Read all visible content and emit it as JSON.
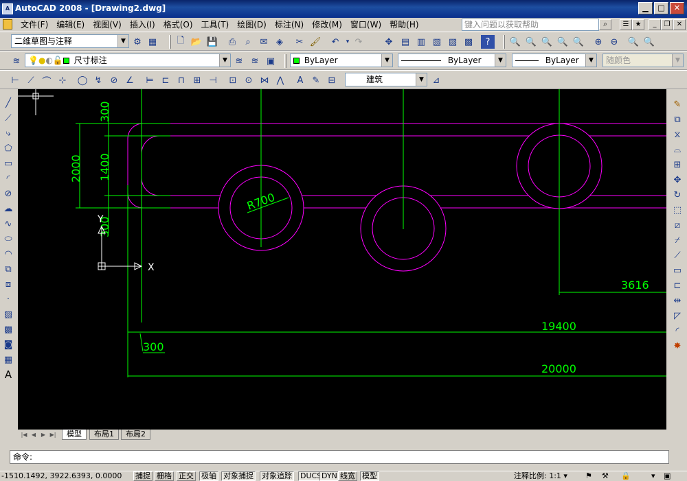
{
  "window": {
    "title": "AutoCAD 2008 - [Drawing2.dwg]",
    "icon": "autocad-icon",
    "minimize": "▁",
    "maximize": "□",
    "close": "✕"
  },
  "menubar": {
    "items": [
      "文件(F)",
      "编辑(E)",
      "视图(V)",
      "插入(I)",
      "格式(O)",
      "工具(T)",
      "绘图(D)",
      "标注(N)",
      "修改(M)",
      "窗口(W)",
      "帮助(H)"
    ],
    "help_search_placeholder": "键入问题以获取帮助"
  },
  "toolbars": {
    "workspace": "二维草图与注释",
    "layer": "尺寸标注",
    "color": "ByLayer",
    "linetype": "ByLayer",
    "lineweight": "ByLayer",
    "plotstyle": "随颜色",
    "dimstyle": "建筑"
  },
  "drawing": {
    "dimensions": {
      "vertical_300_top": "300",
      "vertical_1400": "1400",
      "vertical_2000": "2000",
      "vertical_300_bottom": "300",
      "radius": "R700",
      "horizontal_3616": "3616",
      "horizontal_19400": "19400",
      "horizontal_300": "300",
      "horizontal_20000": "20000"
    },
    "ucs_x": "X",
    "ucs_y": "Y",
    "colors": {
      "background": "#000000",
      "magenta": "#ff00ff",
      "green": "#00ff00",
      "white": "#ffffff"
    }
  },
  "layout_tabs": [
    "模型",
    "布局1",
    "布局2"
  ],
  "command_line": {
    "prompt": "命令:"
  },
  "statusbar": {
    "coordinates": "-1510.1492, 3922.6393, 0.0000",
    "toggles": [
      "捕捉",
      "栅格",
      "正交",
      "极轴",
      "对象捕捉",
      "对象追踪",
      "DUCS",
      "DYN",
      "线宽",
      "模型"
    ],
    "annotation_scale_label": "注释比例:",
    "annotation_scale_value": "1:1"
  }
}
